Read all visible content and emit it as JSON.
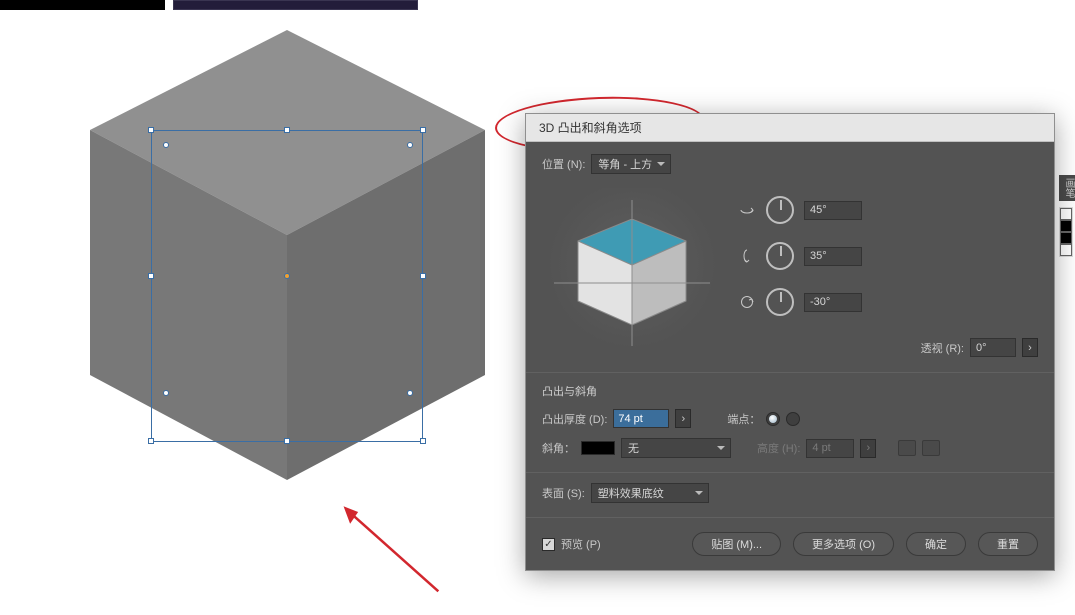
{
  "dialog": {
    "title": "3D 凸出和斜角选项",
    "position_label": "位置 (N):",
    "position_value": "等角 - 上方",
    "rotation_x": "45°",
    "rotation_y": "35°",
    "rotation_z": "-30°",
    "perspective_label": "透视 (R):",
    "perspective_value": "0°",
    "section_extrude": "凸出与斜角",
    "depth_label": "凸出厚度 (D):",
    "depth_value": "74 pt",
    "cap_label": "端点：",
    "bevel_label": "斜角：",
    "bevel_value": "无",
    "height_label": "高度 (H):",
    "height_value": "4 pt",
    "surface_label": "表面 (S):",
    "surface_value": "塑料效果底纹",
    "preview_label": "预览 (P)",
    "buttons": {
      "map": "贴图 (M)...",
      "more": "更多选项 (O)",
      "ok": "确定",
      "reset": "重置"
    }
  },
  "sidebar": {
    "tab": "画笔"
  }
}
